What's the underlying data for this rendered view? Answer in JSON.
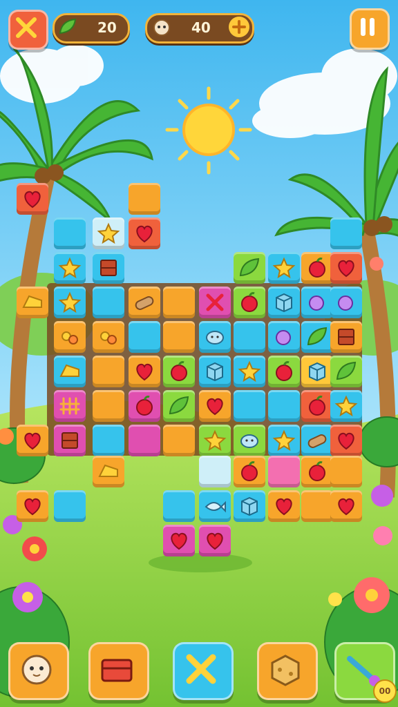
{
  "colors": {
    "sky_top": "#3fb6ef",
    "sky_bottom": "#bfe9fb",
    "grass": "#8fd23e",
    "board_frame": "#7a4a21",
    "orange": "#f7a52b",
    "blue": "#36c3ec",
    "red": "#f0613c",
    "green": "#8bd93f",
    "pink": "#e04fb0",
    "lightpink": "#f36fb0",
    "yellow": "#ffc83a",
    "pale": "#cfeff8"
  },
  "hud": {
    "close_icon": "crossed-tools-icon",
    "resource_icon": "green-leaf-icon",
    "resource_count": "20",
    "pet_icon": "pet-face-icon",
    "pet_count": "40",
    "add_icon": "plus-icon",
    "pause_icon": "pause-icon"
  },
  "tiles": [
    {
      "c": "red",
      "i": "heart"
    },
    {
      "c": "orange",
      "i": ""
    },
    {
      "c": "red",
      "i": "heart"
    },
    {
      "c": "blue",
      "i": ""
    },
    {
      "c": "pale",
      "i": "star"
    },
    {
      "c": "blue",
      "i": ""
    },
    {
      "c": "blue",
      "i": "star"
    },
    {
      "c": "blue",
      "i": "crate"
    },
    {
      "c": "green",
      "i": "leaf"
    },
    {
      "c": "blue",
      "i": "star"
    },
    {
      "c": "orange",
      "i": "apple"
    },
    {
      "c": "red",
      "i": "heart"
    },
    {
      "c": "orange",
      "i": "cheese"
    },
    {
      "c": "blue",
      "i": "star"
    },
    {
      "c": "blue",
      "i": ""
    },
    {
      "c": "orange",
      "i": "log"
    },
    {
      "c": "orange",
      "i": ""
    },
    {
      "c": "pink",
      "i": "cross"
    },
    {
      "c": "green",
      "i": "apple"
    },
    {
      "c": "blue",
      "i": "box"
    },
    {
      "c": "blue",
      "i": "gem"
    },
    {
      "c": "blue",
      "i": "gem"
    },
    {
      "c": "orange",
      "i": "candy"
    },
    {
      "c": "orange",
      "i": "candy"
    },
    {
      "c": "blue",
      "i": ""
    },
    {
      "c": "orange",
      "i": ""
    },
    {
      "c": "blue",
      "i": "blob"
    },
    {
      "c": "blue",
      "i": ""
    },
    {
      "c": "blue",
      "i": "gem"
    },
    {
      "c": "blue",
      "i": "leaf"
    },
    {
      "c": "orange",
      "i": "crate"
    },
    {
      "c": "blue",
      "i": "cheese"
    },
    {
      "c": "orange",
      "i": ""
    },
    {
      "c": "orange",
      "i": "heart"
    },
    {
      "c": "green",
      "i": "apple"
    },
    {
      "c": "blue",
      "i": "box"
    },
    {
      "c": "blue",
      "i": "star"
    },
    {
      "c": "green",
      "i": "apple"
    },
    {
      "c": "yellow",
      "i": "box"
    },
    {
      "c": "green",
      "i": "leaf"
    },
    {
      "c": "pink",
      "i": "fence"
    },
    {
      "c": "orange",
      "i": ""
    },
    {
      "c": "pink",
      "i": "apple"
    },
    {
      "c": "green",
      "i": "leaf"
    },
    {
      "c": "orange",
      "i": "heart"
    },
    {
      "c": "blue",
      "i": ""
    },
    {
      "c": "blue",
      "i": ""
    },
    {
      "c": "red",
      "i": "apple"
    },
    {
      "c": "blue",
      "i": "star"
    },
    {
      "c": "orange",
      "i": "heart"
    },
    {
      "c": "pink",
      "i": "crate"
    },
    {
      "c": "blue",
      "i": ""
    },
    {
      "c": "pink",
      "i": ""
    },
    {
      "c": "orange",
      "i": ""
    },
    {
      "c": "green",
      "i": "star"
    },
    {
      "c": "green",
      "i": "blob"
    },
    {
      "c": "blue",
      "i": "star"
    },
    {
      "c": "blue",
      "i": "log"
    },
    {
      "c": "red",
      "i": "heart"
    },
    {
      "c": "orange",
      "i": "cheese"
    },
    {
      "c": "pale",
      "i": ""
    },
    {
      "c": "orange",
      "i": "apple"
    },
    {
      "c": "lightpink",
      "i": ""
    },
    {
      "c": "orange",
      "i": "apple"
    },
    {
      "c": "orange",
      "i": ""
    },
    {
      "c": "orange",
      "i": "heart"
    },
    {
      "c": "blue",
      "i": ""
    },
    {
      "c": "blue",
      "i": ""
    },
    {
      "c": "blue",
      "i": "fish"
    },
    {
      "c": "blue",
      "i": "box"
    },
    {
      "c": "orange",
      "i": "heart"
    },
    {
      "c": "orange",
      "i": ""
    },
    {
      "c": "orange",
      "i": "heart"
    },
    {
      "c": "pink",
      "i": "heart"
    },
    {
      "c": "pink",
      "i": "heart"
    }
  ],
  "dock": [
    {
      "name": "pet-slot",
      "icon": "pet-face-icon",
      "color": "orange"
    },
    {
      "name": "chest-slot",
      "icon": "chest-icon",
      "color": "orange"
    },
    {
      "name": "tools-slot",
      "icon": "crossed-tools-icon",
      "color": "blue"
    },
    {
      "name": "cheese-slot",
      "icon": "cheese-cube-icon",
      "color": "orange"
    },
    {
      "name": "wand-slot",
      "icon": "magic-wand-icon",
      "color": "green"
    }
  ],
  "dock_badge": "00"
}
